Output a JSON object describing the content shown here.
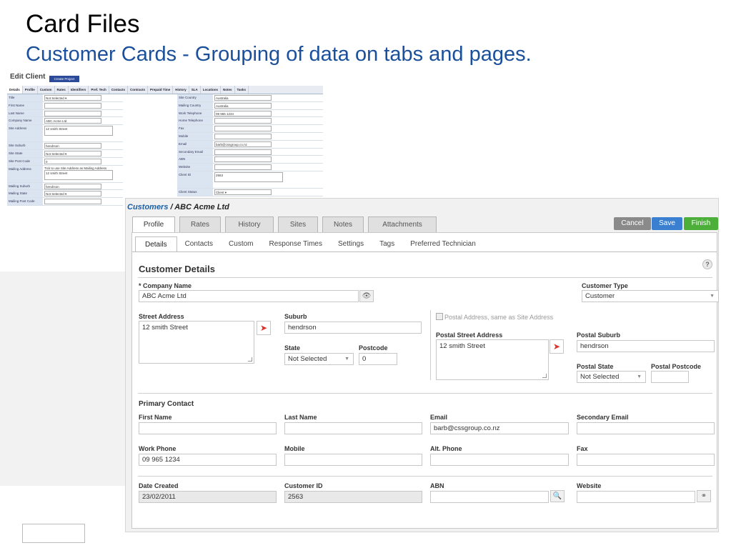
{
  "slide": {
    "title": "Card Files",
    "subtitle": "Customer Cards - Grouping of data on tabs and pages."
  },
  "old_ui": {
    "title": "Edit Client",
    "create_project": "Create Project",
    "tabs": [
      "Details",
      "Profile",
      "Custom",
      "Rates",
      "Identifiers",
      "Pref. Tech",
      "Contacts",
      "Contracts",
      "Prepaid Time",
      "History",
      "SLA",
      "Locations",
      "Notes",
      "Tasks"
    ],
    "left_rows": [
      {
        "label": "Title",
        "value": "Not Selected ▾"
      },
      {
        "label": "First Name",
        "value": ""
      },
      {
        "label": "Last Name",
        "value": ""
      },
      {
        "label": "Company Name",
        "value": "ABC Acme Ltd"
      },
      {
        "label": "Site Address",
        "value": "12 smith Street"
      },
      {
        "label": "Site Suburb",
        "value": "hendrson"
      },
      {
        "label": "Site State",
        "value": "Not Selected ▾"
      },
      {
        "label": "Site Post Code",
        "value": "0"
      },
      {
        "label": "Mailing Address",
        "value": "12 smith Street"
      },
      {
        "label": "Mailing Suburb",
        "value": "hendrson"
      },
      {
        "label": "Mailing State",
        "value": "Not Selected ▾"
      },
      {
        "label": "Mailing Post Code",
        "value": ""
      }
    ],
    "mailing_tick": "Tick to use Site Address as Mailing Address",
    "right_rows": [
      {
        "label": "Site Country",
        "value": "Australia"
      },
      {
        "label": "Mailing Country",
        "value": "Australia"
      },
      {
        "label": "Work Telephone",
        "value": "09 965 1234"
      },
      {
        "label": "Home Telephone",
        "value": ""
      },
      {
        "label": "Fax",
        "value": ""
      },
      {
        "label": "Mobile",
        "value": ""
      },
      {
        "label": "Email",
        "value": "barb@cssgroup.co.nz"
      },
      {
        "label": "Secondary Email",
        "value": ""
      },
      {
        "label": "ABN",
        "value": ""
      },
      {
        "label": "Website",
        "value": ""
      },
      {
        "label": "Client ID",
        "value": "2563"
      },
      {
        "label": "Client Status",
        "value": "Client ▾"
      }
    ]
  },
  "app": {
    "crumb_link": "Customers",
    "crumb_sep": " / ",
    "crumb_current": "ABC Acme Ltd",
    "main_tabs": [
      "Profile",
      "Rates",
      "History",
      "Sites",
      "Notes",
      "Attachments"
    ],
    "buttons": {
      "cancel": "Cancel",
      "save": "Save",
      "finish": "Finish"
    },
    "sub_tabs": [
      "Details",
      "Contacts",
      "Custom",
      "Response Times",
      "Settings",
      "Tags",
      "Preferred Technician"
    ],
    "help": "?",
    "section_title": "Customer Details",
    "company_name_label": "* Company Name",
    "company_name": "ABC Acme Ltd",
    "customer_type_label": "Customer Type",
    "customer_type": "Customer",
    "street_address_label": "Street Address",
    "street_address": "12 smith Street",
    "suburb_label": "Suburb",
    "suburb": "hendrson",
    "state_label": "State",
    "state": "Not Selected",
    "postcode_label": "Postcode",
    "postcode": "0",
    "postal_same_label": "Postal Address, same as Site Address",
    "postal_street_label": "Postal Street Address",
    "postal_street": "12 smith Street",
    "postal_suburb_label": "Postal Suburb",
    "postal_suburb": "hendrson",
    "postal_state_label": "Postal State",
    "postal_state": "Not Selected",
    "postal_postcode_label": "Postal Postcode",
    "postal_postcode": "",
    "primary_contact_title": "Primary Contact",
    "first_name_label": "First Name",
    "first_name": "",
    "last_name_label": "Last Name",
    "last_name": "",
    "email_label": "Email",
    "email": "barb@cssgroup.co.nz",
    "secondary_email_label": "Secondary Email",
    "secondary_email": "",
    "work_phone_label": "Work Phone",
    "work_phone": "09 965 1234",
    "mobile_label": "Mobile",
    "mobile": "",
    "alt_phone_label": "Alt. Phone",
    "alt_phone": "",
    "fax_label": "Fax",
    "fax": "",
    "date_created_label": "Date Created",
    "date_created": "23/02/2011",
    "customer_id_label": "Customer ID",
    "customer_id": "2563",
    "abn_label": "ABN",
    "abn": "",
    "website_label": "Website",
    "website": ""
  }
}
